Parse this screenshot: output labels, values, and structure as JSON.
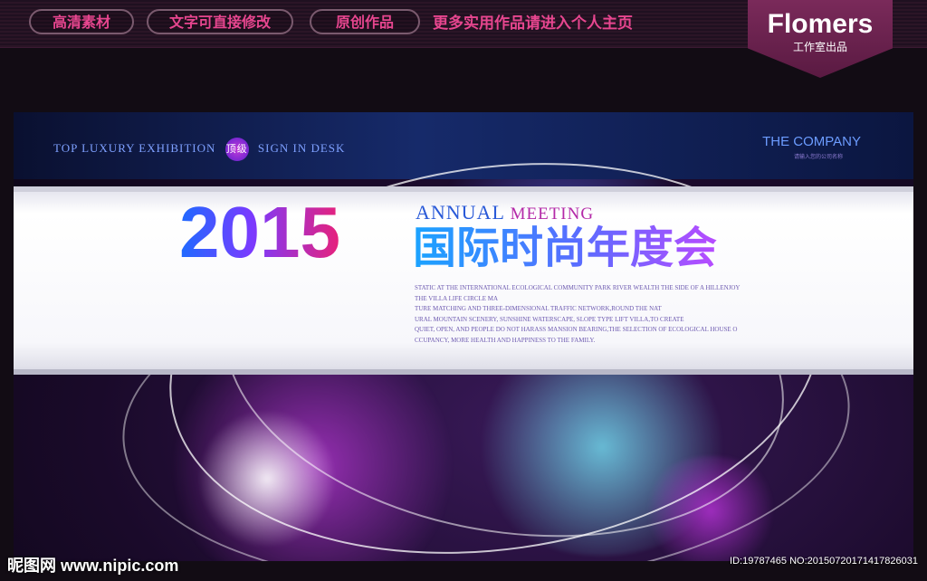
{
  "topbar": {
    "pills": [
      "高清素材",
      "文字可直接修改",
      "原创作品"
    ],
    "link": "更多实用作品请进入个人主页"
  },
  "brand": {
    "name": "Flomers",
    "sub": "工作室出品"
  },
  "banner": {
    "header_left_1": "TOP LUXURY EXHIBITION",
    "badge": "顶级",
    "header_left_2": "SIGN IN DESK",
    "company": "THE COMPANY",
    "company_sub": "请输入您的公司名称",
    "year": "2015",
    "annual": "ANNUAL",
    "meeting": "MEETING",
    "title_cn": "国际时尚年度会",
    "description": "STATIC AT THE INTERNATIONAL ECOLOGICAL COMMUNITY PARK RIVER WEALTH THE SIDE OF A HILLENJOY\nTHE VILLA LIFE CIRCLE MA\nTURE MATCHING AND THREE-DIMENSIONAL TRAFFIC NETWORK,ROUND THE NAT\nURAL MOUNTAIN SCENERY, SUNSHINE WATERSCAPE, SLOPE TYPE LIFT VILLA,TO CREATE\nQUIET, OPEN, AND PEOPLE DO NOT HARASS MANSION BEARING,THE SELECTION OF ECOLOGICAL HOUSE O\nCCUPANCY, MORE HEALTH AND HAPPINESS TO THE FAMILY."
  },
  "footer": {
    "watermark": "昵图网 www.nipic.com",
    "image_id": "ID:19787465 NO:20150720171417826031"
  },
  "colors": {
    "accent_pink": "#e7468f",
    "brand_bg": "#7a2a5a",
    "page_bg": "#120c14"
  }
}
